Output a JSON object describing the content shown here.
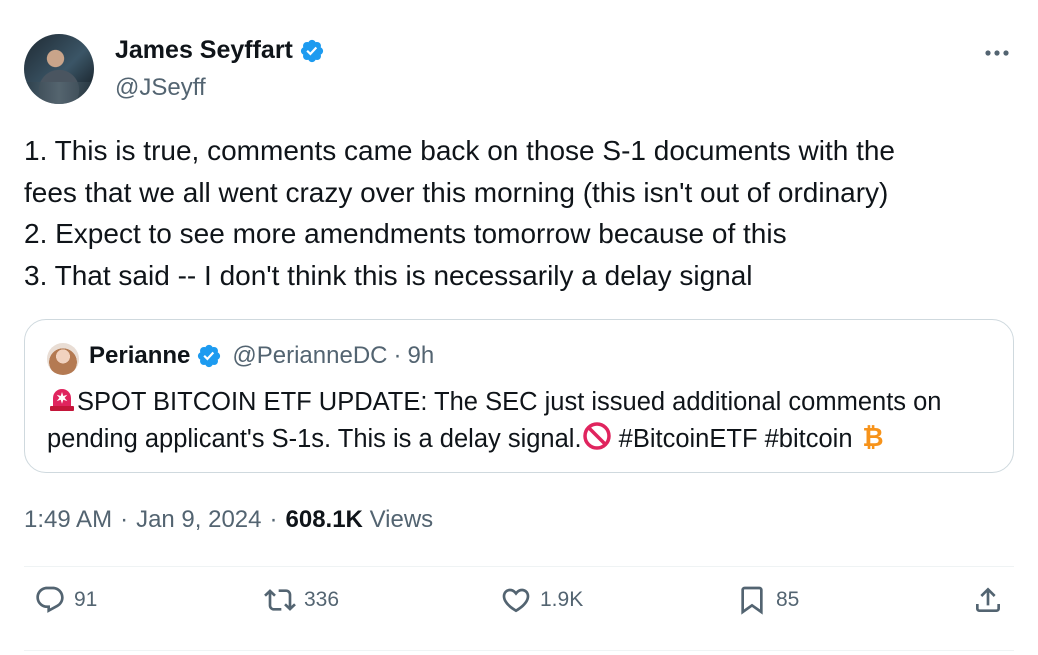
{
  "author": {
    "name": "James Seyffart",
    "handle": "@JSeyff",
    "verified": true
  },
  "body_lines": [
    "1. This is true, comments came back on those S-1 documents with the",
    "fees that we all went crazy over this morning (this isn't out of ordinary)",
    "2. Expect to see more amendments tomorrow because of this",
    "3. That said -- I don't think this is necessarily a delay signal"
  ],
  "quote": {
    "name": "Perianne",
    "handle": "@PerianneDC",
    "separator": "·",
    "time": "9h",
    "line1": "SPOT BITCOIN ETF UPDATE: The SEC just issued additional comments on",
    "line2": "pending applicant's S-1s. This is a delay signal.",
    "hashtags": "#BitcoinETF #bitcoin",
    "emoji_icons": [
      "rotating-light-icon",
      "no-entry-icon",
      "bitcoin-icon"
    ]
  },
  "meta": {
    "time": "1:49 AM",
    "sep1": "·",
    "date": "Jan 9, 2024",
    "sep2": "·",
    "views_count": "608.1K",
    "views_label": "Views"
  },
  "actions": {
    "replies": "91",
    "reposts": "336",
    "likes": "1.9K",
    "bookmarks": "85"
  },
  "colors": {
    "text": "#0f1419",
    "secondary": "#536471",
    "verified": "#1d9bf0",
    "border": "#cfd9de",
    "bitcoin": "#f7931a",
    "alert": "#e0245e"
  }
}
